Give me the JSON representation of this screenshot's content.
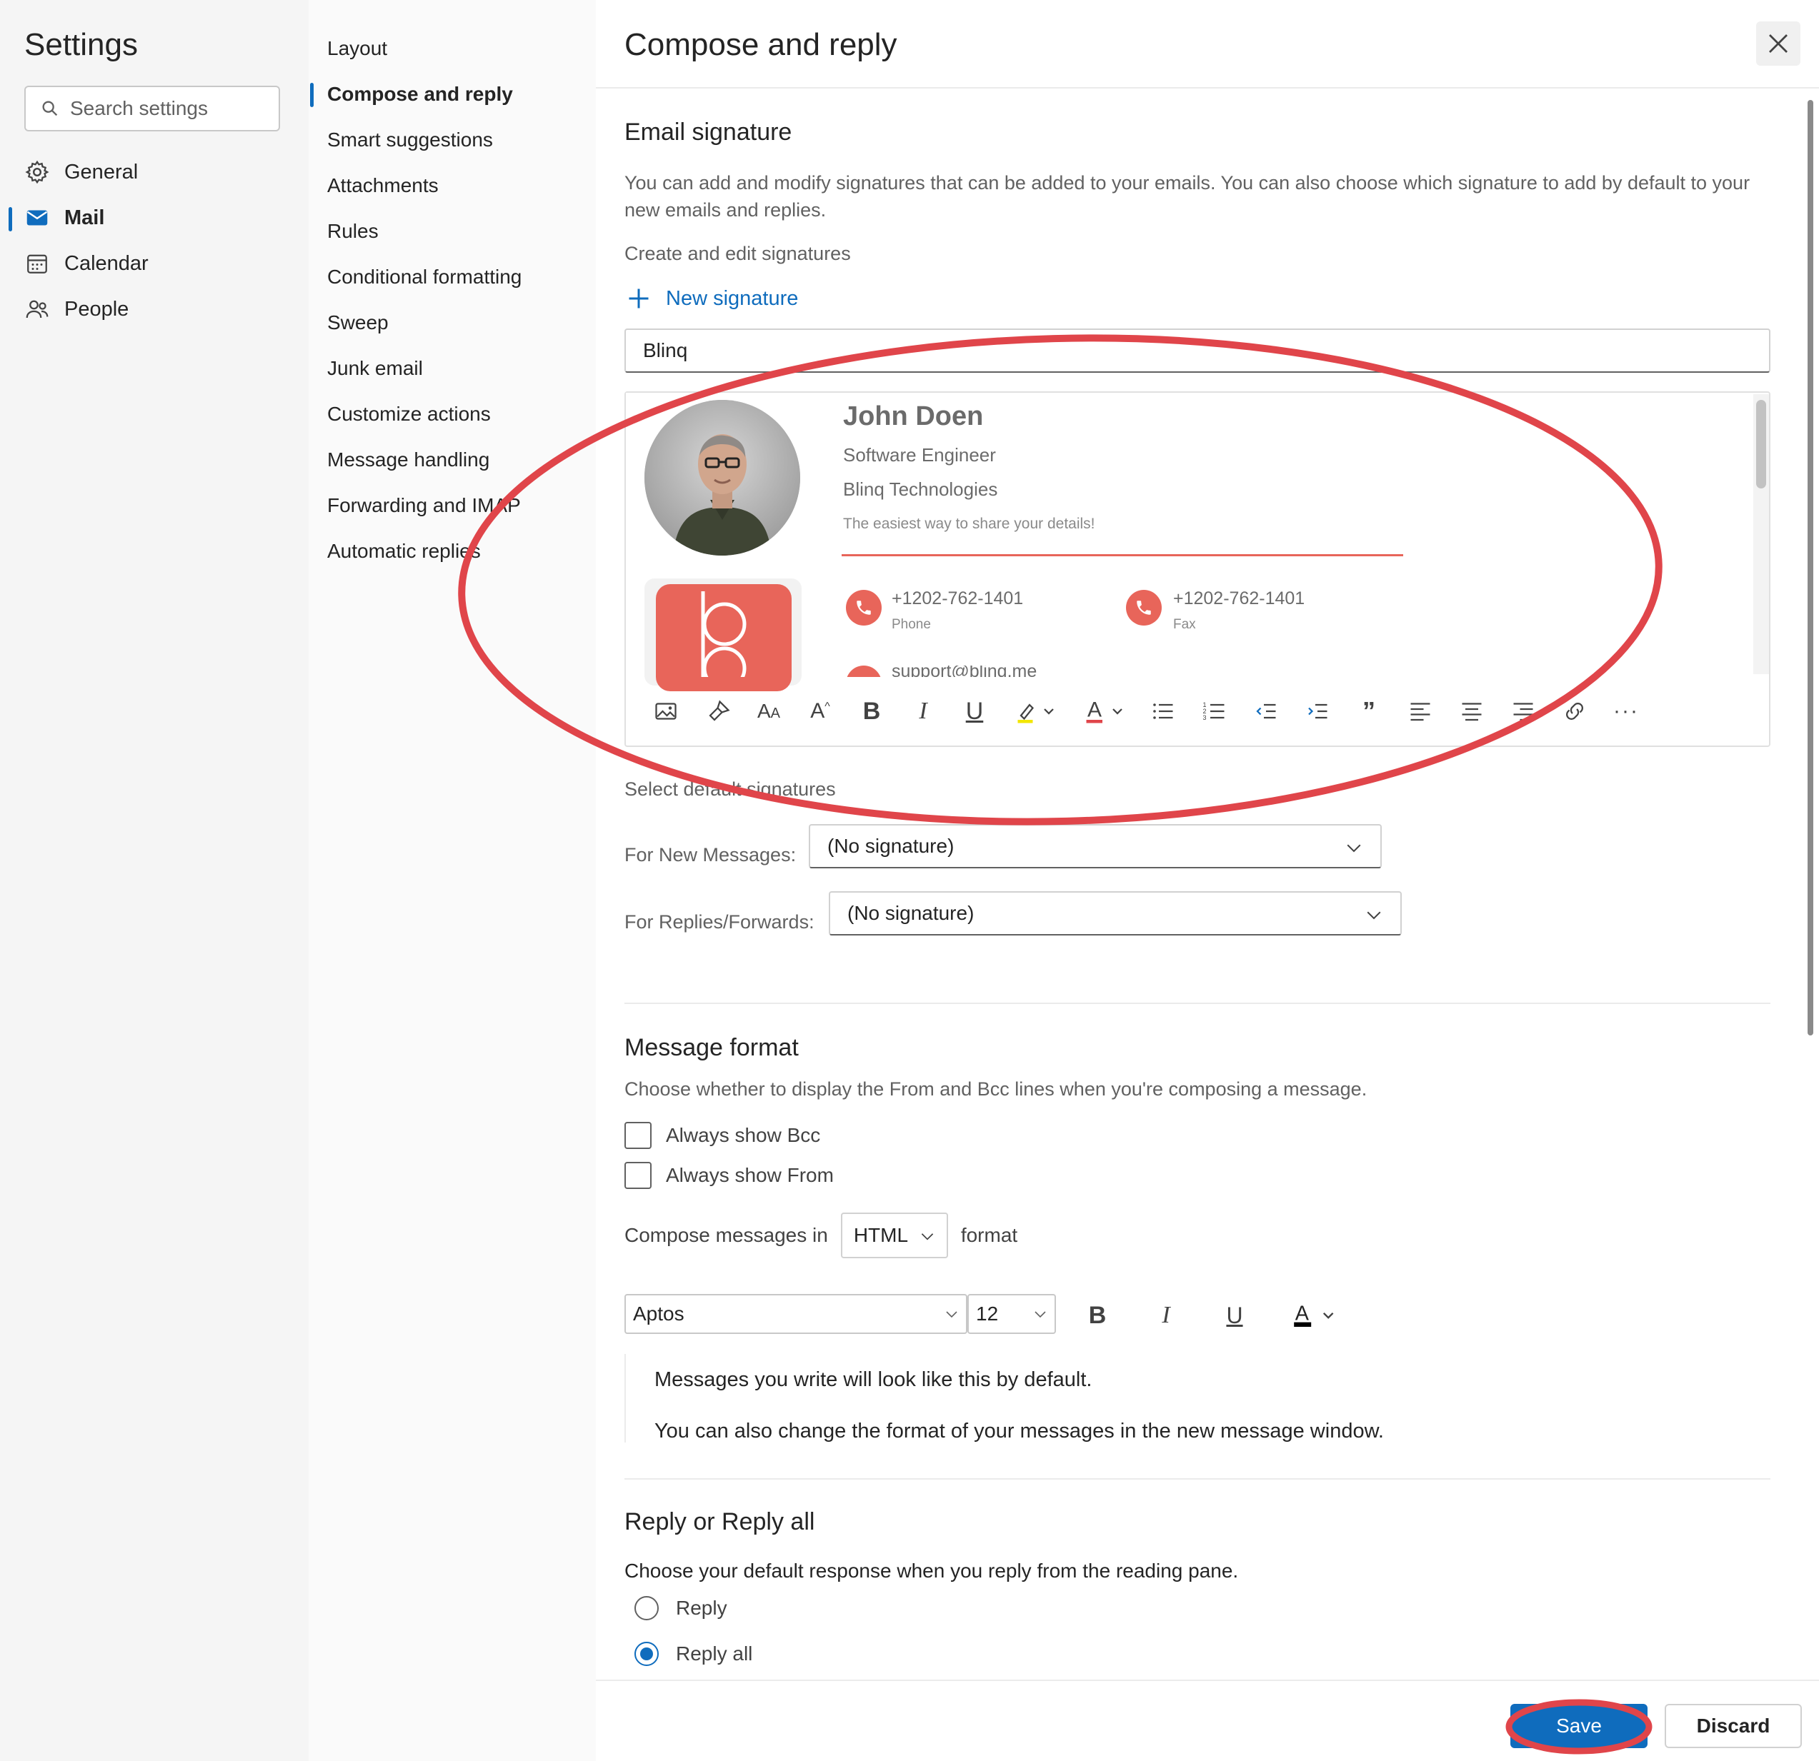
{
  "settings": {
    "title": "Settings",
    "search_placeholder": "Search settings"
  },
  "nav": {
    "items": [
      {
        "label": "General",
        "icon": "gear-icon"
      },
      {
        "label": "Mail",
        "icon": "mail-icon",
        "active": true
      },
      {
        "label": "Calendar",
        "icon": "calendar-icon"
      },
      {
        "label": "People",
        "icon": "people-icon"
      }
    ]
  },
  "subnav": {
    "items": [
      "Layout",
      "Compose and reply",
      "Smart suggestions",
      "Attachments",
      "Rules",
      "Conditional formatting",
      "Sweep",
      "Junk email",
      "Customize actions",
      "Message handling",
      "Forwarding and IMAP",
      "Automatic replies"
    ],
    "active_index": 1
  },
  "page": {
    "title": "Compose and reply"
  },
  "email_signature": {
    "title": "Email signature",
    "description": "You can add and modify signatures that can be added to your emails. You can also choose which signature to add by default to your new emails and replies.",
    "create_label": "Create and edit signatures",
    "new_signature_label": "New signature",
    "signature_name": "Blinq",
    "signature": {
      "name": "John Doen",
      "job_title": "Software Engineer",
      "company": "Blinq Technologies",
      "tagline": "The easiest way to share your details!",
      "phone": "+1202-762-1401",
      "phone_label": "Phone",
      "fax": "+1202-762-1401",
      "fax_label": "Fax",
      "email_partial": "support@blinq.me"
    },
    "default_label": "Select default signatures",
    "new_messages_label": "For New Messages:",
    "new_messages_value": "(No signature)",
    "replies_label": "For Replies/Forwards:",
    "replies_value": "(No signature)"
  },
  "message_format": {
    "title": "Message format",
    "description": "Choose whether to display the From and Bcc lines when you're composing a message.",
    "always_bcc": "Always show Bcc",
    "always_from": "Always show From",
    "compose_prefix": "Compose messages in",
    "compose_value": "HTML",
    "compose_suffix": "format",
    "font": "Aptos",
    "font_size": "12",
    "preview_line1": "Messages you write will look like this by default.",
    "preview_line2": "You can also change the format of your messages in the new message window."
  },
  "reply": {
    "title": "Reply or Reply all",
    "description": "Choose your default response when you reply from the reading pane.",
    "options": [
      "Reply",
      "Reply all"
    ],
    "selected": "Reply all"
  },
  "footer": {
    "save": "Save",
    "discard": "Discard"
  },
  "colors": {
    "accent": "#0f6cbd",
    "annotation": "#e0454a",
    "brand": "#e8655a"
  }
}
